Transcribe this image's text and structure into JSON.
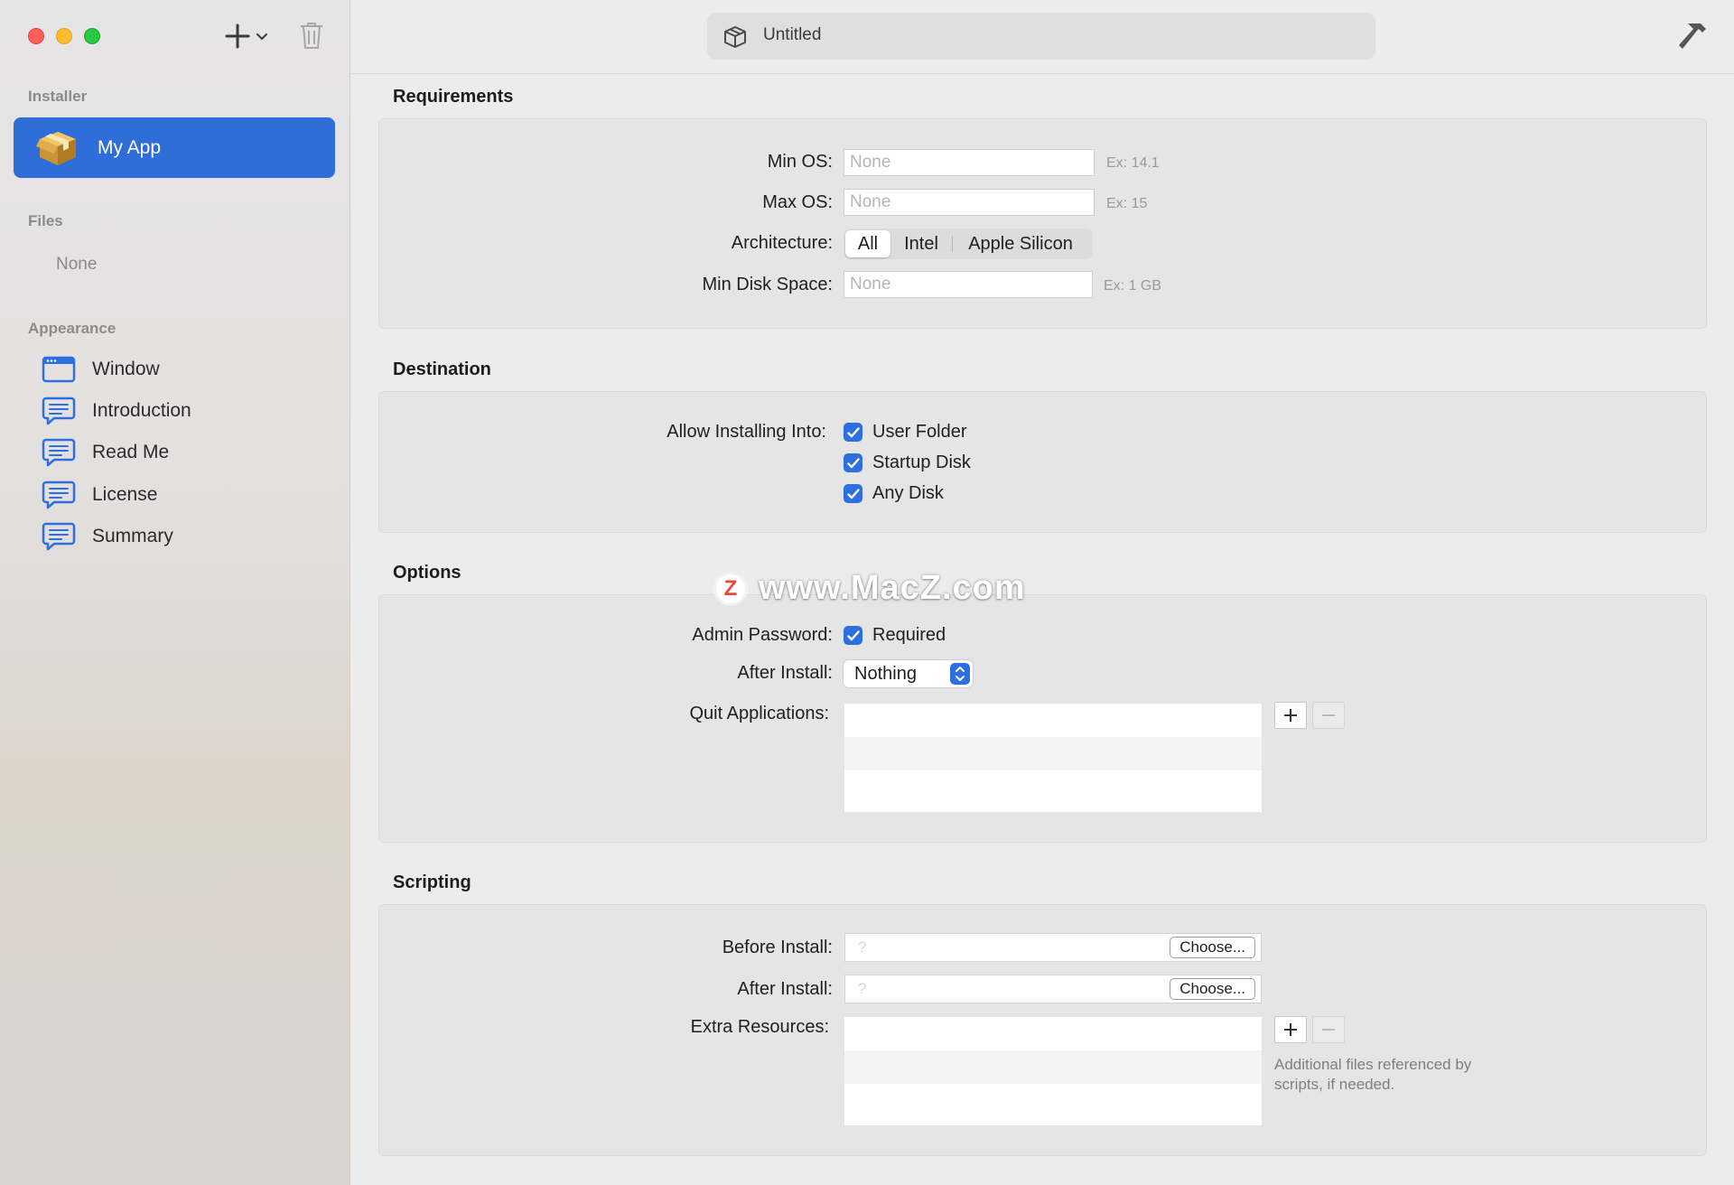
{
  "window": {
    "title": "Untitled"
  },
  "sidebar": {
    "installer_header": "Installer",
    "selected_item": "My App",
    "files_header": "Files",
    "files_empty": "None",
    "appearance_header": "Appearance",
    "appearance_items": [
      {
        "label": "Window",
        "icon": "window-icon"
      },
      {
        "label": "Introduction",
        "icon": "speech-bubble-icon"
      },
      {
        "label": "Read Me",
        "icon": "speech-bubble-icon"
      },
      {
        "label": "License",
        "icon": "speech-bubble-icon"
      },
      {
        "label": "Summary",
        "icon": "speech-bubble-icon"
      }
    ]
  },
  "requirements": {
    "title": "Requirements",
    "min_os_label": "Min OS:",
    "min_os_placeholder": "None",
    "min_os_hint": "Ex: 14.1",
    "max_os_label": "Max OS:",
    "max_os_placeholder": "None",
    "max_os_hint": "Ex: 15",
    "architecture_label": "Architecture:",
    "architecture_options": [
      "All",
      "Intel",
      "Apple Silicon"
    ],
    "architecture_selected": "All",
    "min_disk_label": "Min Disk Space:",
    "min_disk_placeholder": "None",
    "min_disk_hint": "Ex: 1 GB"
  },
  "destination": {
    "title": "Destination",
    "allow_label": "Allow Installing Into:",
    "options": [
      {
        "label": "User Folder",
        "checked": true
      },
      {
        "label": "Startup Disk",
        "checked": true
      },
      {
        "label": "Any Disk",
        "checked": true
      }
    ]
  },
  "options": {
    "title": "Options",
    "admin_label": "Admin Password:",
    "admin_value": "Required",
    "after_install_label": "After Install:",
    "after_install_value": "Nothing",
    "quit_apps_label": "Quit Applications:"
  },
  "scripting": {
    "title": "Scripting",
    "before_install_label": "Before Install:",
    "after_install_label": "After Install:",
    "choose_label": "Choose...",
    "extra_resources_label": "Extra Resources:",
    "extra_note": "Additional files referenced by scripts, if needed."
  },
  "watermark": {
    "text": "www.MacZ.com",
    "badge": "Z"
  },
  "colors": {
    "accent": "#2f6ed8",
    "checkbox": "#2e6fe0"
  }
}
